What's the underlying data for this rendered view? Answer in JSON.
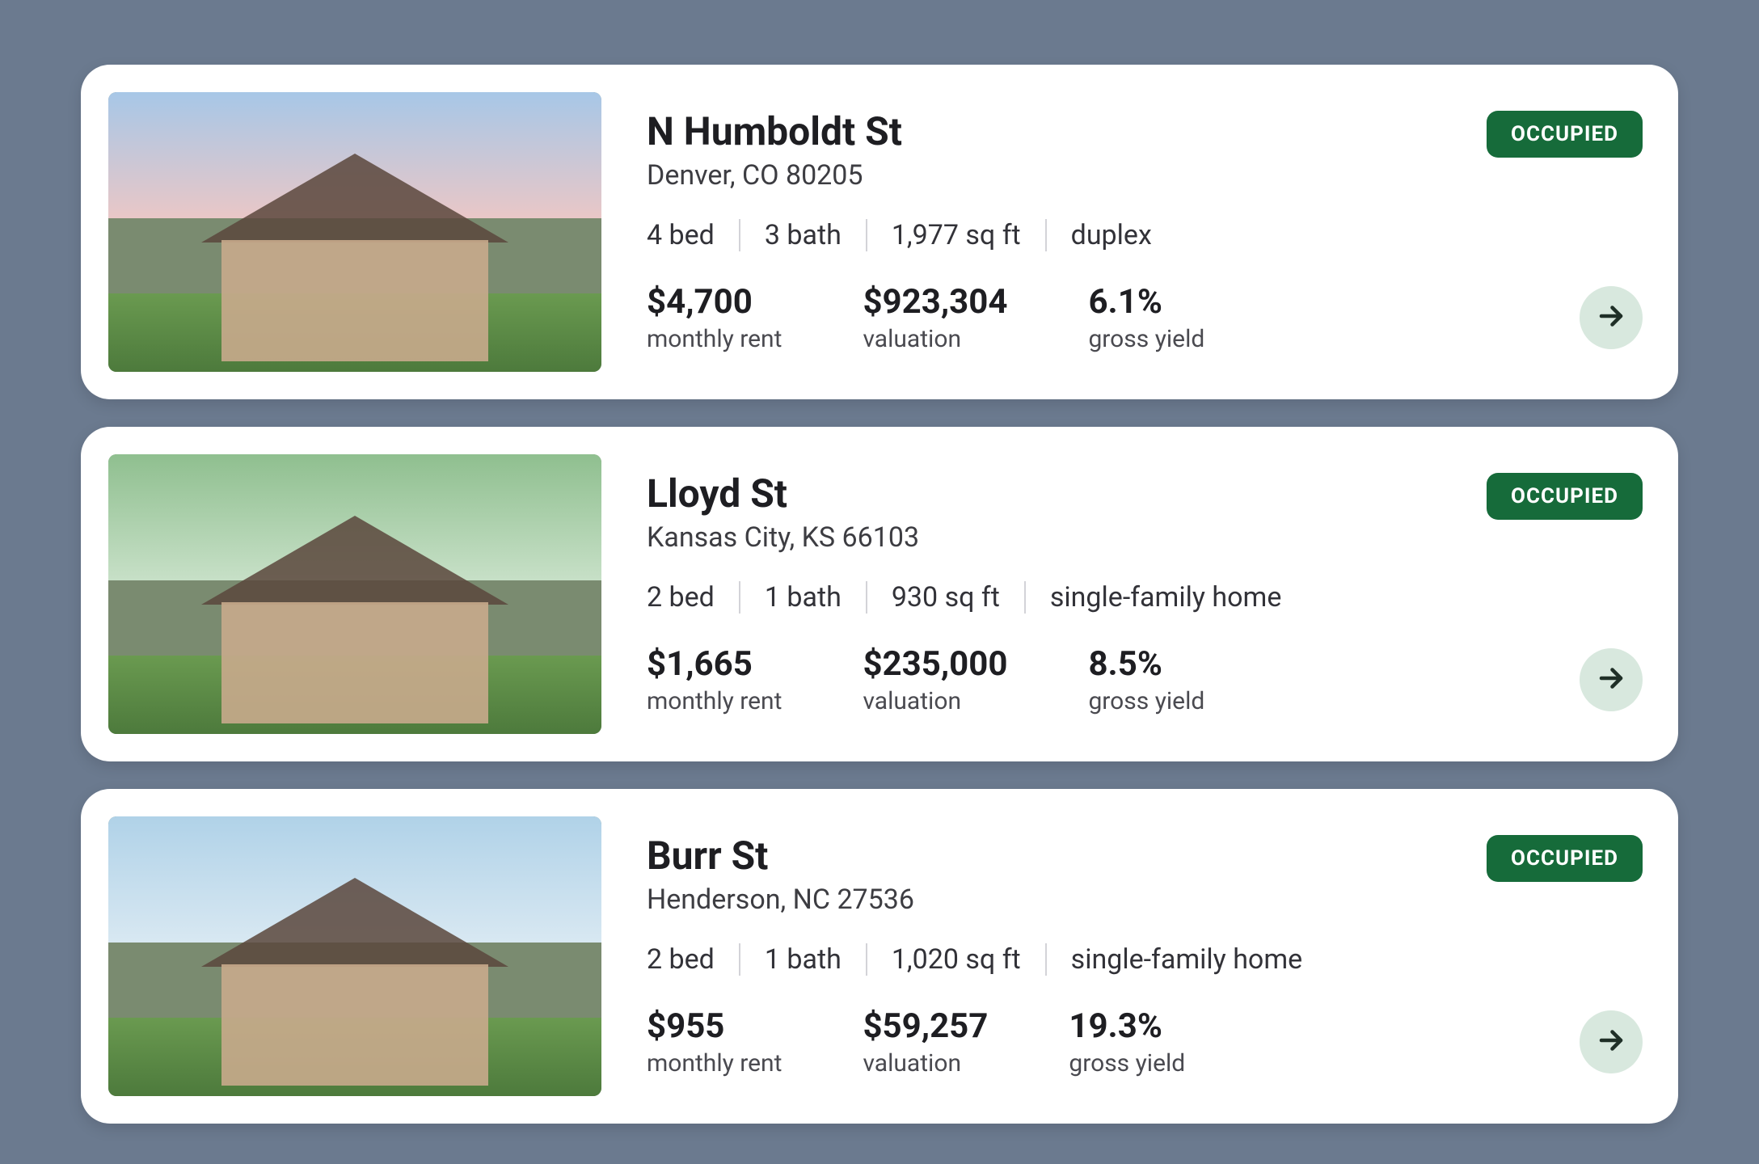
{
  "status_label": "OCCUPIED",
  "metric_labels": {
    "rent": "monthly rent",
    "valuation": "valuation",
    "yield": "gross yield"
  },
  "listings": [
    {
      "title": "N Humboldt St",
      "location": "Denver, CO 80205",
      "specs": {
        "bed": "4 bed",
        "bath": "3 bath",
        "sqft": "1,977 sq ft",
        "type": "duplex"
      },
      "rent": "$4,700",
      "valuation": "$923,304",
      "yield": "6.1%",
      "thumb_style": "style-a"
    },
    {
      "title": "Lloyd St",
      "location": "Kansas City, KS 66103",
      "specs": {
        "bed": "2 bed",
        "bath": "1 bath",
        "sqft": "930 sq ft",
        "type": "single-family home"
      },
      "rent": "$1,665",
      "valuation": "$235,000",
      "yield": "8.5%",
      "thumb_style": "style-b"
    },
    {
      "title": "Burr St",
      "location": "Henderson, NC 27536",
      "specs": {
        "bed": "2 bed",
        "bath": "1 bath",
        "sqft": "1,020 sq ft",
        "type": "single-family home"
      },
      "rent": "$955",
      "valuation": "$59,257",
      "yield": "19.3%",
      "thumb_style": "style-c"
    }
  ]
}
